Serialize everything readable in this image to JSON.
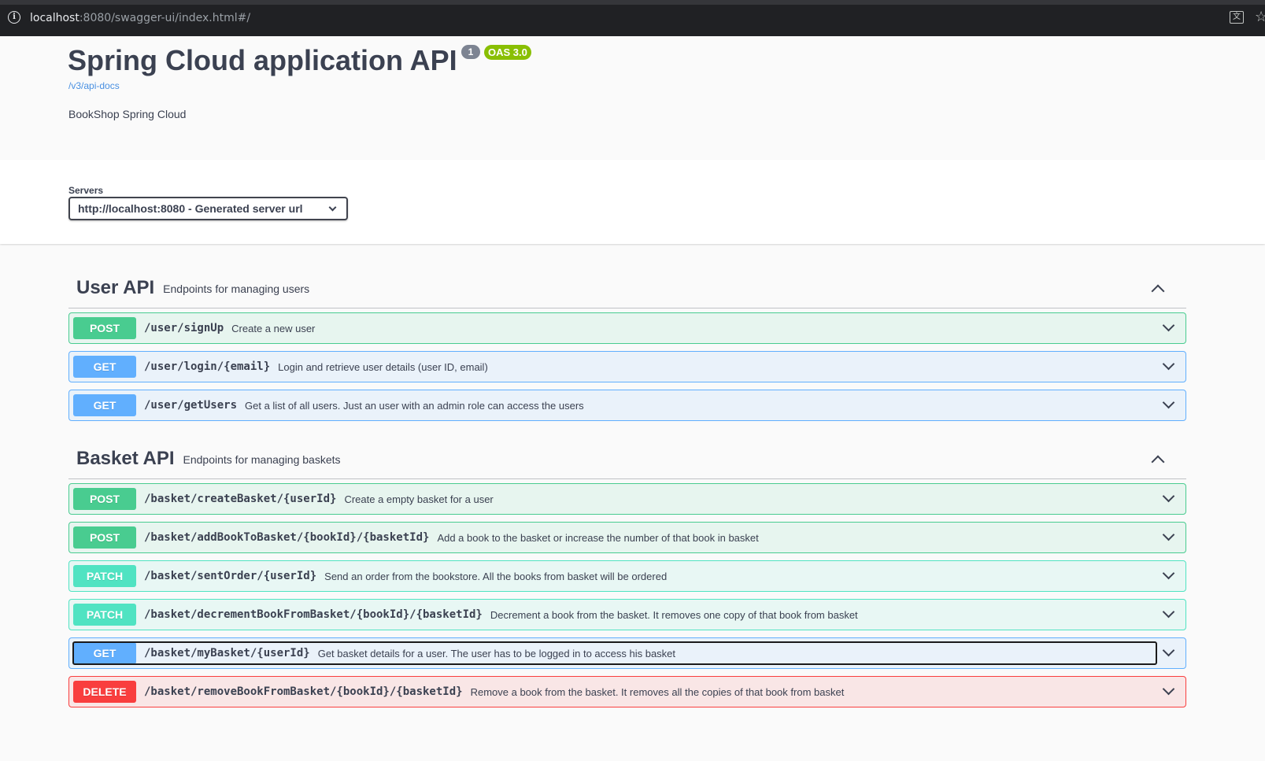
{
  "browser": {
    "url_host": "localhost",
    "url_rest": ":8080/swagger-ui/index.html#/",
    "info_icon": "info-icon",
    "translate_icon": "translate-icon",
    "star_icon": "star-icon"
  },
  "info": {
    "title": "Spring Cloud application API",
    "version": "1",
    "oas": "OAS 3.0",
    "api_link": "/v3/api-docs",
    "description": "BookShop Spring Cloud"
  },
  "servers": {
    "label": "Servers",
    "selected": "http://localhost:8080 - Generated server url"
  },
  "colors": {
    "post": "#49cc90",
    "get": "#61affe",
    "patch": "#50e3c2",
    "delete": "#f93e3e",
    "oas_badge": "#89bf04",
    "version_badge": "#7d8492"
  },
  "tags": [
    {
      "name": "User API",
      "description": "Endpoints for managing users",
      "operations": [
        {
          "method": "POST",
          "path": "/user/signUp",
          "summary": "Create a new user"
        },
        {
          "method": "GET",
          "path": "/user/login/{email}",
          "summary": "Login and retrieve user details (user ID, email)"
        },
        {
          "method": "GET",
          "path": "/user/getUsers",
          "summary": "Get a list of all users. Just an user with an admin role can access the users"
        }
      ]
    },
    {
      "name": "Basket API",
      "description": "Endpoints for managing baskets",
      "operations": [
        {
          "method": "POST",
          "path": "/basket/createBasket/{userId}",
          "summary": "Create a empty basket for a user"
        },
        {
          "method": "POST",
          "path": "/basket/addBookToBasket/{bookId}/{basketId}",
          "summary": "Add a book to the basket or increase the number of that book in basket"
        },
        {
          "method": "PATCH",
          "path": "/basket/sentOrder/{userId}",
          "summary": "Send an order from the bookstore. All the books from basket will be ordered"
        },
        {
          "method": "PATCH",
          "path": "/basket/decrementBookFromBasket/{bookId}/{basketId}",
          "summary": "Decrement a book from the basket. It removes one copy of that book from basket"
        },
        {
          "method": "GET",
          "path": "/basket/myBasket/{userId}",
          "summary": "Get basket details for a user. The user has to be logged in to access his basket"
        },
        {
          "method": "DELETE",
          "path": "/basket/removeBookFromBasket/{bookId}/{basketId}",
          "summary": "Remove a book from the basket. It removes all the copies of that book from basket"
        }
      ]
    }
  ]
}
